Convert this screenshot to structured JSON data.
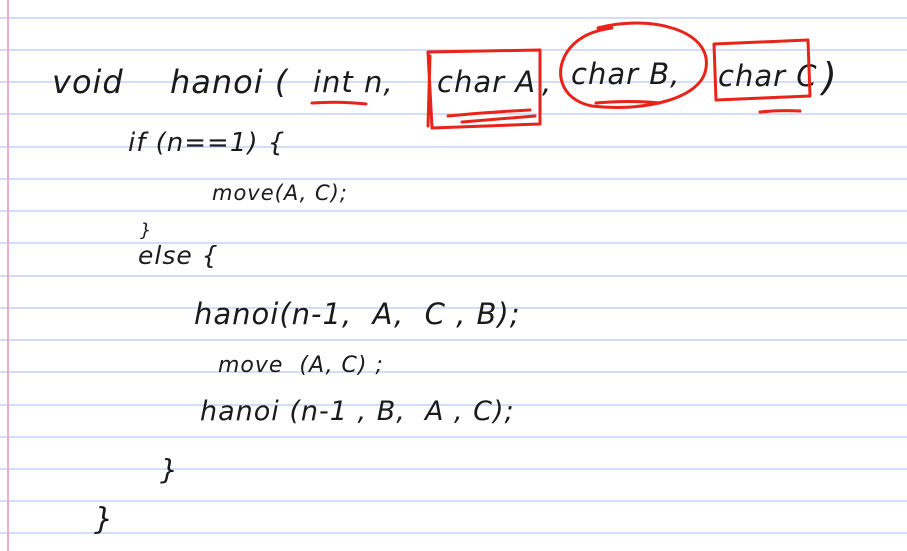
{
  "notebook": {
    "ruled_line_color": "#aab8f0",
    "margin_line_color": "#f2a8c8",
    "paper_color": "#ffffff",
    "ink_color": "#1a1a1a",
    "annotation_color": "#e8231a"
  },
  "code_lines": {
    "line1_void": "void",
    "line1_hanoi": "hanoi (",
    "line1_int_n": "int n,",
    "line1_char_a": "char A",
    "line1_comma1": ",",
    "line1_char_b": "char B,",
    "line1_char_c": "char C",
    "line1_close": ")",
    "line2": "if (n==1) {",
    "line3": "move(A, C);",
    "line4": "}",
    "line5": "else {",
    "line6": "hanoi(n-1,  A,  C , B);",
    "line7": "move  (A, C) ;",
    "line8": "hanoi (n-1 , B,  A , C);",
    "line9": "}",
    "line10": "}"
  }
}
